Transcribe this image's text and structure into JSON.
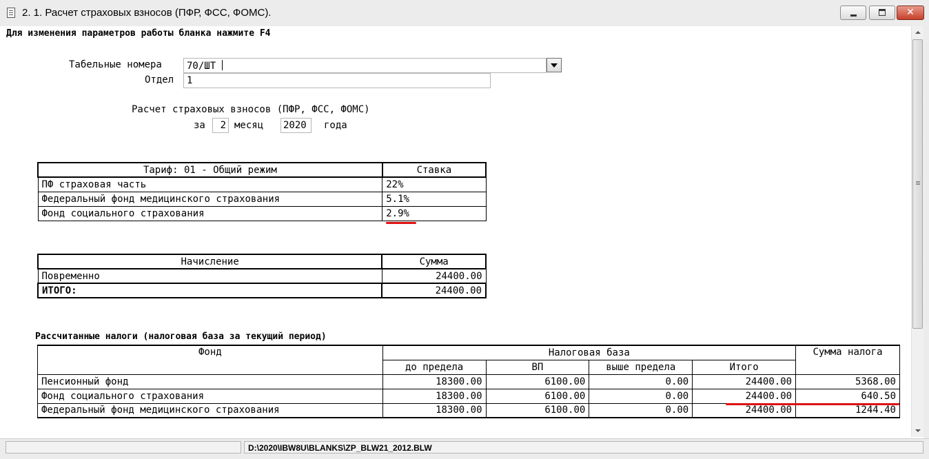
{
  "window": {
    "title": "2. 1. Расчет страховых взносов (ПФР, ФСС, ФОМС).",
    "close_glyph": "✕"
  },
  "hint": "Для изменения параметров работы бланка нажмите F4",
  "params": {
    "tab_label": "Табельные номера",
    "tab_value": "70/ШТ",
    "dept_label": "Отдел",
    "dept_value": "1",
    "calc_title": "Расчет страховых взносов (ПФР, ФСС, ФОМС)",
    "period_prefix": "за",
    "month_value": "2",
    "month_label": "месяц",
    "year_value": "2020",
    "year_label": "года"
  },
  "tariff_table": {
    "headers": [
      "Тариф: 01 - Общий режим",
      "Ставка"
    ],
    "rows": [
      [
        "ПФ страховая часть",
        "22%"
      ],
      [
        "Федеральный фонд медицинского страхования",
        "5.1%"
      ],
      [
        "Фонд социального страхования",
        "2.9%"
      ]
    ]
  },
  "accrual_table": {
    "headers": [
      "Начисление",
      "Сумма"
    ],
    "rows": [
      [
        "Повременно",
        "24400.00"
      ]
    ],
    "total": [
      "ИТОГО:",
      "24400.00"
    ]
  },
  "taxes": {
    "title": "Рассчитанные налоги (налоговая база за текущий период)",
    "head_fund": "Фонд",
    "head_base": "Налоговая база",
    "head_tax": "Сумма налога",
    "sub_headers": [
      "до предела",
      "ВП",
      "выше предела",
      "Итого"
    ],
    "rows": [
      [
        "Пенсионный фонд",
        "18300.00",
        "6100.00",
        "0.00",
        "24400.00",
        "5368.00"
      ],
      [
        "Фонд социального страхования",
        "18300.00",
        "6100.00",
        "0.00",
        "24400.00",
        "640.50"
      ],
      [
        "Федеральный фонд медицинского страхования",
        "18300.00",
        "6100.00",
        "0.00",
        "24400.00",
        "1244.40"
      ]
    ]
  },
  "status": {
    "path": "D:\\2020\\IBW8U\\BLANKS\\ZP_BLW21_2012.BLW"
  },
  "colors": {
    "annotation": "#dd1111",
    "close_button": "#c7402a"
  }
}
